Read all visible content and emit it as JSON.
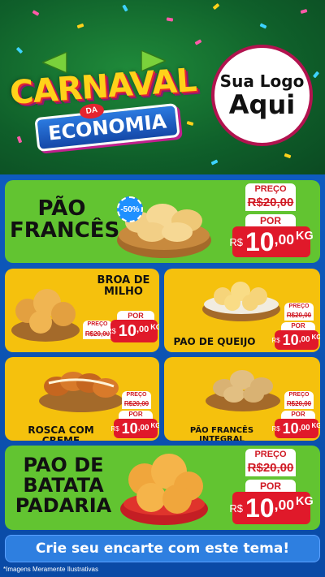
{
  "header": {
    "brand_line1": "CARNAVAL",
    "brand_da": "DA",
    "brand_line2": "ECONOMIA",
    "logo_line1": "Sua Logo",
    "logo_line2": "Aqui"
  },
  "products": [
    {
      "name_lines": [
        "PÃO",
        "FRANCÊS"
      ],
      "badge": "-50%",
      "preco_label": "PREÇO",
      "old_price": "R$20,00",
      "por_label": "POR",
      "new_currency": "R$",
      "new_int": "10",
      "new_cents": ",00",
      "unit": "KG",
      "icon": "bread-rolls-basket-icon"
    },
    {
      "name_lines": [
        "BROA DE",
        "MILHO"
      ],
      "preco_label": "PREÇO",
      "old_price": "R$20,00",
      "por_label": "POR",
      "new_currency": "R$",
      "new_int": "10",
      "new_cents": ",00",
      "unit": "KG",
      "icon": "corn-bread-basket-icon"
    },
    {
      "name_lines": [
        "PAO DE QUEIJO"
      ],
      "preco_label": "PREÇO",
      "old_price": "R$20,00",
      "por_label": "POR",
      "new_currency": "R$",
      "new_int": "10",
      "new_cents": ",00",
      "unit": "KG",
      "icon": "cheese-bread-basket-icon"
    },
    {
      "name_lines": [
        "ROSCA COM CREME"
      ],
      "preco_label": "PREÇO",
      "old_price": "R$20,00",
      "por_label": "POR",
      "new_currency": "R$",
      "new_int": "10",
      "new_cents": ",00",
      "unit": "KG",
      "icon": "braided-bread-icon"
    },
    {
      "name_lines": [
        "PÃO FRANCÊS INTEGRAL"
      ],
      "preco_label": "PREÇO",
      "old_price": "R$20,00",
      "por_label": "POR",
      "new_currency": "R$",
      "new_int": "10",
      "new_cents": ",00",
      "unit": "KG",
      "icon": "whole-wheat-rolls-icon"
    },
    {
      "name_lines": [
        "PAO DE",
        "BATATA",
        "PADARIA"
      ],
      "preco_label": "PREÇO",
      "old_price": "R$20,00",
      "por_label": "POR",
      "new_currency": "R$",
      "new_int": "10",
      "new_cents": ",00",
      "unit": "KG",
      "icon": "potato-bread-bowl-icon"
    }
  ],
  "footer": {
    "cta": "Crie seu encarte com este tema!",
    "disclaimer": "*Imagens Meramente Ilustrativas"
  },
  "colors": {
    "green_card": "#62c431",
    "yellow_card": "#f5c10d",
    "price_red": "#e0192a",
    "background_blue": "#0d57b8"
  }
}
